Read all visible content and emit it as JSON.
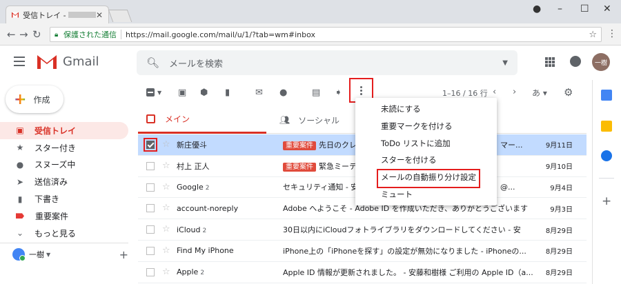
{
  "browser": {
    "tab_title": "受信トレイ -",
    "secure_label": "保護された通信",
    "url": "https://mail.google.com/mail/u/1/?tab=wm#inbox"
  },
  "header": {
    "logo_text": "Gmail",
    "search_placeholder": "メールを検索",
    "avatar_text": "一樹"
  },
  "sidebar": {
    "compose_label": "作成",
    "items": [
      {
        "label": "受信トレイ",
        "icon": "inbox-icon",
        "active": true
      },
      {
        "label": "スター付き",
        "icon": "star-icon"
      },
      {
        "label": "スヌーズ中",
        "icon": "clock-icon"
      },
      {
        "label": "送信済み",
        "icon": "send-icon"
      },
      {
        "label": "下書き",
        "icon": "draft-icon"
      },
      {
        "label": "重要案件",
        "icon": "label-icon"
      },
      {
        "label": "もっと見る",
        "icon": "chevron-down-icon"
      }
    ],
    "user_name": "一樹"
  },
  "toolbar": {
    "pager_text": "1–16 / 16 行",
    "lang_label": "あ"
  },
  "tabs": {
    "main": "メイン",
    "social": "ソーシャル"
  },
  "menu": {
    "items": [
      "未読にする",
      "重要マークを付ける",
      "ToDo リストに追加",
      "スターを付ける",
      "メールの自動振り分け設定",
      "ミュート"
    ],
    "highlighted_index": 4
  },
  "emails": [
    {
      "sender": "新庄優斗",
      "count": "",
      "badge": "重要案件",
      "subject": "先日のクレ",
      "tail": "マー...",
      "date": "9月11日",
      "selected": true
    },
    {
      "sender": "村上 正人",
      "count": "",
      "badge": "重要案件",
      "subject": "緊急ミーテ",
      "tail": "",
      "date": "9月10日",
      "selected": false
    },
    {
      "sender": "Google",
      "count": "2",
      "badge": "",
      "subject": "セキュリティ通知 - 安",
      "tail": "@...",
      "date": "9月4日",
      "selected": false
    },
    {
      "sender": "account-noreply",
      "count": "",
      "badge": "",
      "subject": "Adobe へようこそ - Adobe ID を作成いただき、ありがとうございます",
      "tail": "",
      "date": "9月3日",
      "selected": false
    },
    {
      "sender": "iCloud",
      "count": "2",
      "badge": "",
      "subject": "30日以内にiCloudフォトライブラリをダウンロードしてください - 安",
      "tail": "",
      "date": "8月29日",
      "selected": false
    },
    {
      "sender": "Find My iPhone",
      "count": "",
      "badge": "",
      "subject": "iPhone上の「iPhoneを探す」の設定が無効になりました - iPhoneの...",
      "tail": "",
      "date": "8月29日",
      "selected": false
    },
    {
      "sender": "Apple",
      "count": "2",
      "badge": "",
      "subject": "Apple ID 情報が更新されました。 - 安藤和樹様 ご利用の Apple ID（a...",
      "tail": "",
      "date": "8月29日",
      "selected": false
    }
  ],
  "colors": {
    "accent_red": "#d93025",
    "highlight_outline": "#e41d1d",
    "selected_row": "#c2dbff",
    "badge": "#e04b3c"
  }
}
